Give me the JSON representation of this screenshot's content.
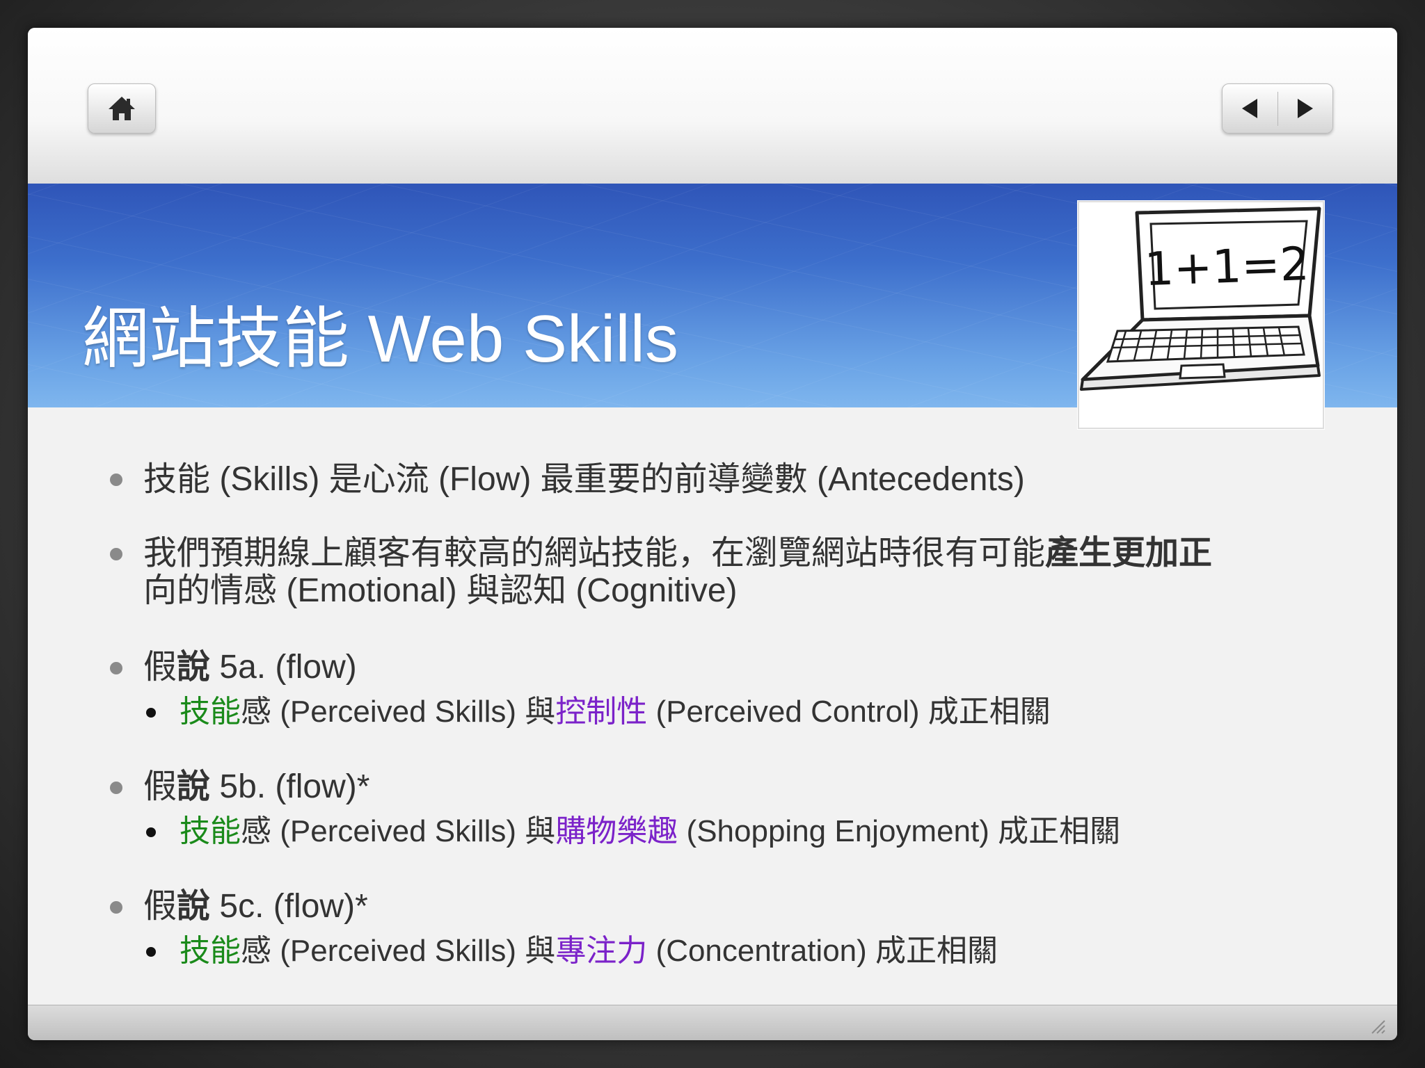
{
  "title": "網站技能 Web Skills",
  "laptop_screen_text": "1+1=2",
  "bullets": [
    {
      "text": "技能 (Skills) 是心流 (Flow) 最重要的前導變數 (Antecedents)"
    },
    {
      "line1_prefix": "我們預期線上顧客有較高的網站技能，在瀏覽網站時很有可能",
      "line1_bold": "產生更加正",
      "line2": "向的情感 (Emotional) 與認知 (Cognitive)"
    },
    {
      "prefix": "假",
      "bold": "說",
      "suffix": " 5a. (flow)",
      "sub": {
        "green": "技能",
        "text1": "感 (Perceived Skills) 與",
        "purple": "控制性",
        "text2": " (Perceived Control) 成正相關"
      }
    },
    {
      "prefix": "假",
      "bold": "說",
      "suffix": " 5b. (flow)*",
      "sub": {
        "green": "技能",
        "text1": "感 (Perceived Skills) 與",
        "purple": "購物樂趣",
        "text2": " (Shopping Enjoyment) 成正相關"
      }
    },
    {
      "prefix": "假",
      "bold": "說",
      "suffix": " 5c. (flow)*",
      "sub": {
        "green": "技能",
        "text1": "感 (Perceived Skills) 與",
        "purple": "專注力",
        "text2": " (Concentration) 成正相關"
      }
    }
  ],
  "colors": {
    "banner_top": "#2f55b8",
    "banner_bottom": "#7fb6ee",
    "highlight_green": "#1a8a1a",
    "highlight_purple": "#7b22c9"
  },
  "icons": [
    "home-icon",
    "previous-arrow-icon",
    "next-arrow-icon",
    "laptop-illustration-icon",
    "resize-grip-icon"
  ]
}
